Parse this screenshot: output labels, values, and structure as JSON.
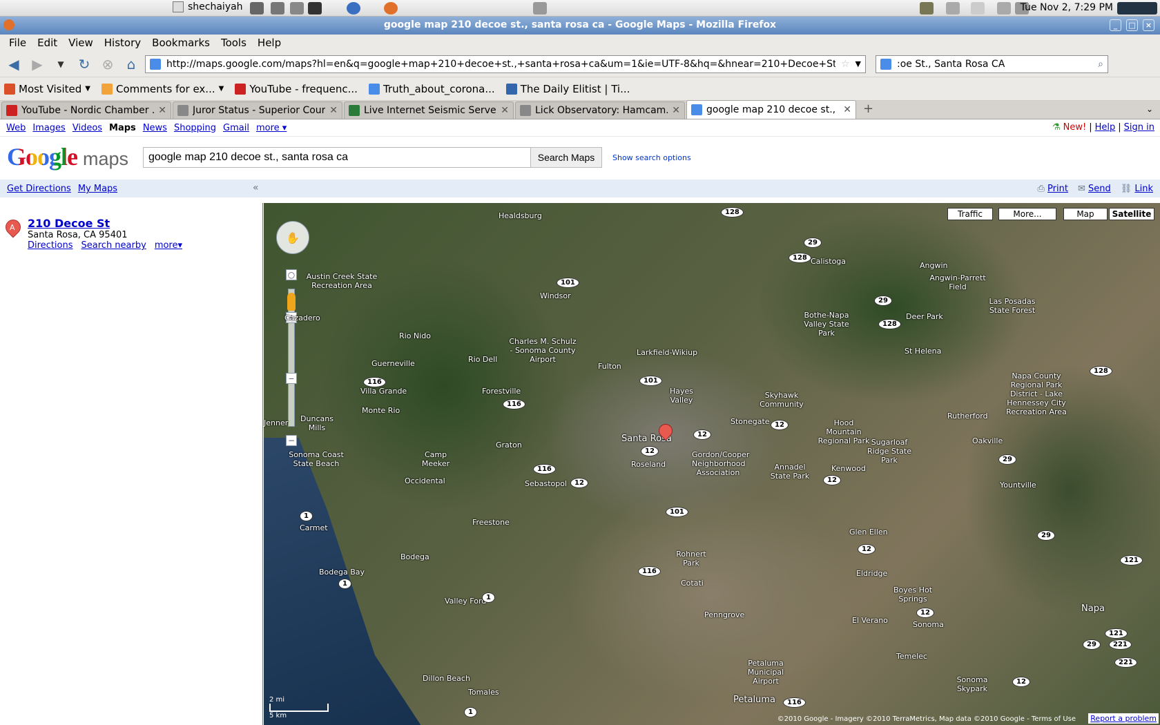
{
  "panel": {
    "user": "shechaiyah",
    "clock": "Tue Nov  2,  7:29 PM"
  },
  "window": {
    "title": "google map 210 decoe st., santa rosa ca - Google Maps - Mozilla Firefox"
  },
  "menu": [
    "File",
    "Edit",
    "View",
    "History",
    "Bookmarks",
    "Tools",
    "Help"
  ],
  "nav": {
    "url": "http://maps.google.com/maps?hl=en&q=google+map+210+decoe+st.,+santa+rosa+ca&um=1&ie=UTF-8&hq=&hnear=210+Decoe+St,+Santa+Rosa,+CA+95",
    "search_value": ":oe St., Santa Rosa CA"
  },
  "bookmarks": [
    {
      "label": "Most Visited",
      "color": "#d9502a"
    },
    {
      "label": "Comments for ex...",
      "color": "#f2a33a"
    },
    {
      "label": "YouTube - frequenc...",
      "color": "#cc2222"
    },
    {
      "label": "Truth_about_corona...",
      "color": "#4a8de8"
    },
    {
      "label": "The Daily Elitist | Ti...",
      "color": "#3366aa"
    }
  ],
  "tabs": [
    {
      "label": "YouTube - Nordic Chamber ...",
      "color": "#cc2222"
    },
    {
      "label": "Juror Status - Superior Cour...",
      "color": "#888888"
    },
    {
      "label": "Live Internet Seismic Server",
      "color": "#2a7a3a"
    },
    {
      "label": "Lick Observatory: Hamcam...",
      "color": "#888888"
    },
    {
      "label": "google map 210 decoe st., ...",
      "color": "#4a8de8"
    }
  ],
  "gnav": {
    "links": [
      "Web",
      "Images",
      "Videos",
      "Maps",
      "News",
      "Shopping",
      "Gmail",
      "more ▾"
    ],
    "new_label": "New!",
    "help": "Help",
    "signin": "Sign in",
    "sep": "|"
  },
  "header": {
    "logo": "Google",
    "logo_sub": "maps",
    "query": "google map 210 decoe st., santa rosa ca",
    "search_button": "Search Maps",
    "options": "Show search options"
  },
  "strip": {
    "get_directions": "Get Directions",
    "my_maps": "My Maps",
    "collapse": "«",
    "print": "Print",
    "send": "Send",
    "link": "Link"
  },
  "result": {
    "marker": "A",
    "name": "210 Decoe St",
    "address": "Santa Rosa, CA 95401",
    "directions": "Directions",
    "search_nearby": "Search nearby",
    "more": "more▾"
  },
  "map": {
    "controls": [
      "Traffic",
      "More...",
      "Map",
      "Satellite"
    ],
    "labels": [
      "Healdsburg",
      "Calistoga",
      "Angwin",
      "Angwin-Parrett Field",
      "Windsor",
      "Austin Creek State Recreation Area",
      "Bothe-Napa Valley State Park",
      "Las Posadas State Forest",
      "Deer Park",
      "Cazadero",
      "Rio Nido",
      "Charles M. Schulz - Sonoma County Airport",
      "Larkfield-Wikiup",
      "St Helena",
      "Guerneville",
      "Rio Dell",
      "Fulton",
      "Forestville",
      "Villa Grande",
      "Monte Rio",
      "Hayes Valley",
      "Skyhawk Community",
      "Hood Mountain Regional Park",
      "Napa County Regional Park District - Lake Hennessey City Recreation Area",
      "Jenner",
      "Duncans Mills",
      "Graton",
      "Santa Rosa",
      "Stonegate",
      "Rutherford",
      "Sugarloaf Ridge State Park",
      "Oakville",
      "Sonoma Coast State Beach",
      "Camp Meeker",
      "Roseland",
      "Gordon/Cooper Neighborhood Association",
      "Annadel State Park",
      "Kenwood",
      "Occidental",
      "Sebastopol",
      "Yountville",
      "Carmet",
      "Freestone",
      "Glen Ellen",
      "Bodega",
      "Rohnert Park",
      "Eldridge",
      "Bodega Bay",
      "Cotati",
      "Boyes Hot Springs",
      "Valley Ford",
      "Napa",
      "Penngrove",
      "El Verano",
      "Sonoma",
      "Temelec",
      "Petaluma Municipal Airport",
      "Sonoma Skypark",
      "Dillon Beach",
      "Tomales",
      "Petaluma"
    ],
    "shields": [
      "128",
      "29",
      "128",
      "101",
      "29",
      "128",
      "128",
      "116",
      "101",
      "116",
      "12",
      "12",
      "12",
      "116",
      "12",
      "1",
      "29",
      "101",
      "12",
      "121",
      "116",
      "1",
      "1",
      "29",
      "12",
      "121",
      "29",
      "221",
      "221",
      "12",
      "12",
      "116",
      "1"
    ],
    "scale_mi": "2 mi",
    "scale_km": "5 km",
    "copyright": "©2010 Google - Imagery ©2010 TerraMetrics, Map data ©2010 Google - Terms of Use",
    "report": "Report a problem"
  }
}
